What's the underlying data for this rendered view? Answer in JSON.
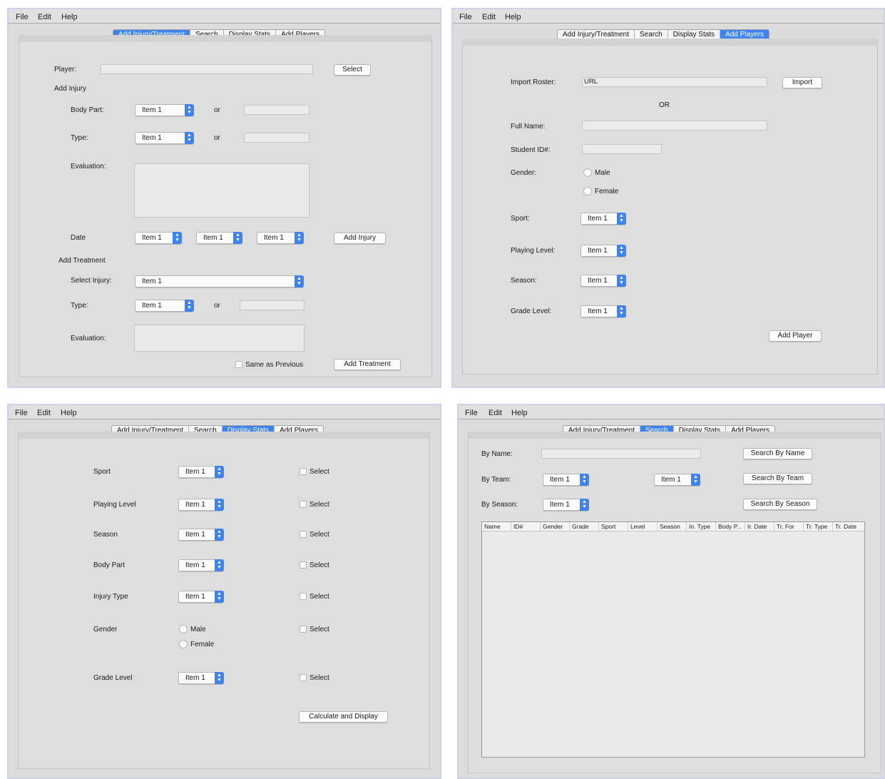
{
  "menu": [
    "File",
    "Edit",
    "Help"
  ],
  "tabs": [
    "Add Injury/Treatment",
    "Search",
    "Display Stats",
    "Add Players"
  ],
  "combo_default": "Item 1",
  "injury_window": {
    "active_tab": "Add Injury/Treatment",
    "player_label": "Player:",
    "select_button": "Select",
    "add_injury_heading": "Add Injury",
    "body_part_label": "Body Part:",
    "or_label": "or",
    "type_label": "Type:",
    "evaluation_label": "Evaluation:",
    "date_label": "Date",
    "add_injury_button": "Add Injury",
    "add_treatment_heading": "Add Treatment",
    "select_injury_label": "Select Injury:",
    "treatment_type_label": "Type:",
    "treatment_evaluation_label": "Evaluation:",
    "same_as_previous": "Same as Previous",
    "add_treatment_button": "Add Treatment"
  },
  "players_window": {
    "active_tab": "Add Players",
    "import_roster_label": "Import Roster:",
    "import_url_value": "URL",
    "import_button": "Import",
    "or_text": "OR",
    "full_name_label": "Full Name:",
    "student_id_label": "Student ID#:",
    "gender_label": "Gender:",
    "male": "Male",
    "female": "Female",
    "sport_label": "Sport:",
    "playing_level_label": "Playing Level:",
    "season_label": "Season:",
    "grade_level_label": "Grade Level:",
    "add_player_button": "Add Player"
  },
  "stats_window": {
    "active_tab": "Display Stats",
    "rows": [
      "Sport",
      "Playing Level",
      "Season",
      "Body Part",
      "Injury Type",
      "Gender",
      "Grade Level"
    ],
    "select_label": "Select",
    "male": "Male",
    "female": "Female",
    "calculate_button": "Calculate and Display"
  },
  "search_window": {
    "active_tab": "Search",
    "by_name_label": "By Name:",
    "by_team_label": "By Team:",
    "by_season_label": "By Season:",
    "search_by_name_button": "Search By Name",
    "search_by_team_button": "Search By Team",
    "search_by_season_button": "Search By Season",
    "columns": [
      "Name",
      "ID#",
      "Gender",
      "Grade",
      "Sport",
      "Level",
      "Season",
      "In. Type",
      "Body P...",
      "Ir. Date",
      "Tr. For",
      "Tr. Type",
      "Tr. Date"
    ]
  },
  "colors": {
    "accent": "#3d84f2",
    "window_bg": "#dcdcdc",
    "window_border": "#cfd0ec"
  }
}
